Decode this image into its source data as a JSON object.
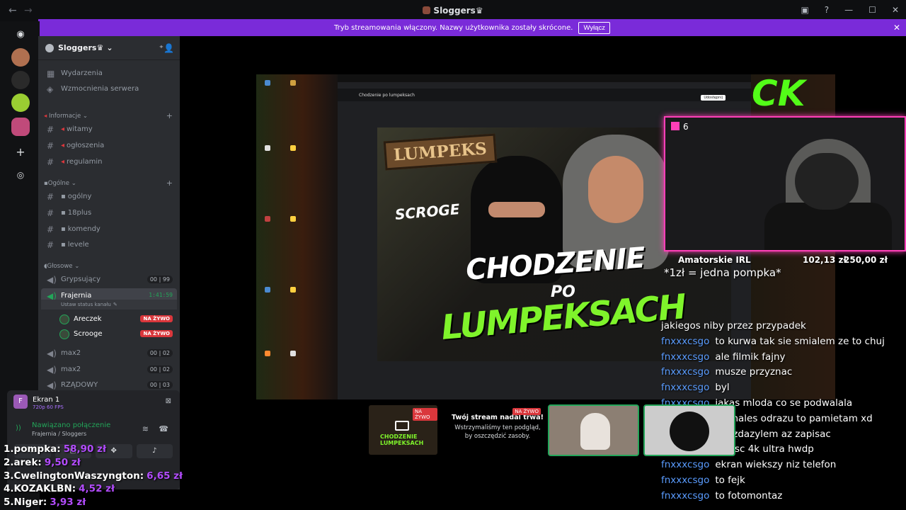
{
  "window": {
    "title": "Sloggers",
    "crown_icon": "crown-icon"
  },
  "banner": {
    "text": "Tryb streamowania włączony. Nazwy użytkownika zostały skrócone.",
    "button": "Wyłącz"
  },
  "server": {
    "name": "Sloggers"
  },
  "sidebar_top": [
    {
      "label": "Wydarzenia",
      "icon": "calendar-icon"
    },
    {
      "label": "Wzmocnienia serwera",
      "icon": "boost-icon"
    }
  ],
  "categories": {
    "info": "Informacje",
    "general": "Ogólne",
    "voice": "Głosowe"
  },
  "info_channels": [
    "witamy",
    "ogłoszenia",
    "regulamin"
  ],
  "general_channels": [
    "ogólny",
    "18plus",
    "komendy",
    "levele"
  ],
  "voice_channels": {
    "grypsujacy": {
      "name": "Grypsujący",
      "a": "00",
      "b": "99"
    },
    "frajernia": {
      "name": "Frajernia",
      "timer": "1:41:59",
      "status": "Ustaw status kanału"
    },
    "members": [
      {
        "name": "Areczek",
        "badge": "NA ŻYWO"
      },
      {
        "name": "Scrooge",
        "badge": "NA ŻYWO"
      }
    ],
    "max2a": {
      "name": "max2",
      "a": "00",
      "b": "02"
    },
    "max2b": {
      "name": "max2",
      "a": "00",
      "b": "02"
    },
    "rzadowy": {
      "name": "RZĄDOWY",
      "a": "00",
      "b": "03"
    }
  },
  "panel": {
    "screen_title": "Ekran 1",
    "screen_sub": "720p 60 FPS",
    "connected": "Nawiązano połączenie",
    "location": "Frajernia / Sloggers"
  },
  "webcam": {
    "platform": "kick",
    "count": "6"
  },
  "goal": {
    "name": "Amatorskie IRL",
    "current": "102,13 zł",
    "target": "250,00 zł"
  },
  "pompka": "*1zł = jedna pompka*",
  "chat": [
    {
      "user": "",
      "text": "jakiegos niby przez przypadek"
    },
    {
      "user": "fnxxxcsgo",
      "text": "to kurwa tak sie smialem ze to chuj"
    },
    {
      "user": "fnxxxcsgo",
      "text": "ale filmik fajny"
    },
    {
      "user": "fnxxxcsgo",
      "text": "musze przyznac"
    },
    {
      "user": "fnxxxcsgo",
      "text": "byl"
    },
    {
      "user": "fnxxxcsgo",
      "text": "jakas mloda co se podwalala"
    },
    {
      "user": "fnxxxcsgo",
      "text": "usunales odrazu to pamietam xd"
    },
    {
      "user": "fnxxxcsgo",
      "text": "nie zdazylem az zapisac"
    },
    {
      "user": "fnxxxcsgo",
      "text": "jakosc 4k ultra hwdp"
    },
    {
      "user": "fnxxxcsgo",
      "text": "ekran wiekszy niz telefon"
    },
    {
      "user": "fnxxxcsgo",
      "text": "to fejk"
    },
    {
      "user": "fnxxxcsgo",
      "text": "to fotomontaz"
    }
  ],
  "thumbnail": {
    "tag": "LUMPEKS",
    "scroge": "SCROGE",
    "line1": "CHODZENIE",
    "line2": "PO",
    "line3": "LUMPEKSACH"
  },
  "browser": {
    "tab_title": "Chodzenie po lumpeksach",
    "button": "Udostępnij"
  },
  "stream_strip": {
    "badge": "NA ŻYWO",
    "mini_title": "CHODZENIE LUMPEKSACH",
    "paused_title": "Twój stream nadal trwa!",
    "paused_desc": "Wstrzymaliśmy ten podgląd, by oszczędzić zasoby."
  },
  "leaderboard": [
    {
      "rank": "1.",
      "name": "pompka:",
      "amount": "58,90 zł"
    },
    {
      "rank": "2.",
      "name": "arek:",
      "amount": "9,50 zł"
    },
    {
      "rank": "3.",
      "name": "CwelingtonWaszyngton:",
      "amount": "6,65 zł"
    },
    {
      "rank": "4.",
      "name": "KOZAKLBN:",
      "amount": "4,52 zł"
    },
    {
      "rank": "5.",
      "name": "Niger:",
      "amount": "3,93 zł"
    }
  ],
  "colors": {
    "accent": "#7a2bd9",
    "live": "#da373c",
    "kick": "#53fc18",
    "webcam_border": "#ff3fb8",
    "chat_user": "#5a9cff",
    "donation": "#b34cff"
  }
}
